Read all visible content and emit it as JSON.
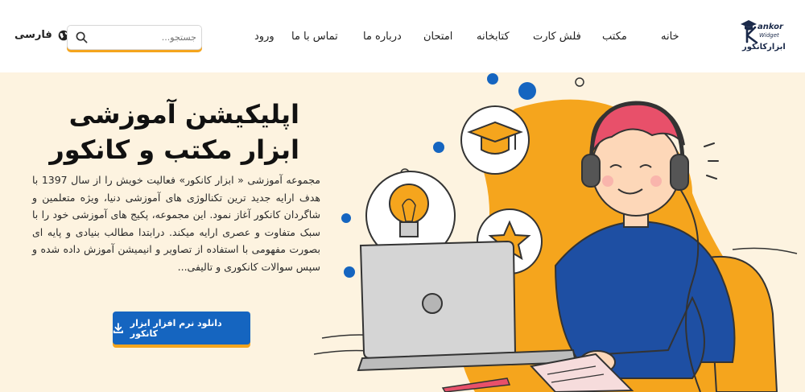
{
  "header": {
    "lang_label": "فارسی",
    "search": {
      "placeholder": "جستجو..."
    },
    "nav": {
      "home": "خانه",
      "school": "مکتب",
      "flashcard": "فلش کارت",
      "library": "کتابخانه",
      "exam": "امتحان",
      "about": "درباره ما",
      "contact": "تماس با ما",
      "login": "ورود"
    },
    "logo": {
      "top_text": "ankor",
      "sub_text": "Widget",
      "caption": "ابزارکانکور"
    }
  },
  "hero": {
    "title_line1": "اپلیکیشن آموزشی",
    "title_line2": "ابزار مکتب و کانکور",
    "description": "مجموعه آموزشی « ابزار کانکور» فعالیت خویش را از سال 1397 با هدف ارایه جدید ترین تکنالوژی های آموزشی دنیا، ویژه متعلمین و شاگردان کانکور آغاز نمود. این مجموعه، پکیج های آموزشی خود را با سبک متفاوت و عصری ارایه میکند. درابتدا مطالب بنیادی و پایه ای بصورت مفهومی با استفاده از تصاویر و انیمیشن آموزش داده شده و سپس سوالات کانکوری و تالیفی...",
    "download_label": "دانلود نرم افزار ابزار کانکور"
  },
  "colors": {
    "background": "#fdf3e0",
    "accent_orange": "#f5a51d",
    "primary_blue": "#1565c0"
  },
  "icons": [
    "globe-icon",
    "search-icon",
    "download-icon"
  ]
}
